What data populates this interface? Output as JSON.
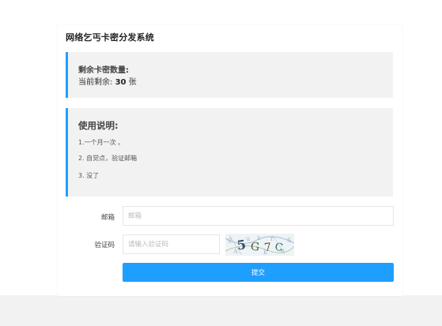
{
  "app": {
    "title": "网络乞丐卡密分发系统"
  },
  "remaining": {
    "title": "剩余卡密数量:",
    "prefix": "当前剩余:",
    "count": "30",
    "unit": "张"
  },
  "instructions": {
    "title": "使用说明:",
    "items": [
      "1.一个月一次 。",
      "2. 自觉点，验证邮箱",
      "3. 没了"
    ]
  },
  "form": {
    "email_label": "邮箱",
    "email_placeholder": "邮箱",
    "email_value": "",
    "captcha_label": "验证码",
    "captcha_placeholder": "请输入验证码",
    "captcha_value": "",
    "captcha_image_text": "5G7C",
    "submit_label": "提交"
  },
  "colors": {
    "accent": "#1e9fff",
    "panel_bg": "#f2f2f2",
    "page_bg": "#f2f2f2"
  }
}
